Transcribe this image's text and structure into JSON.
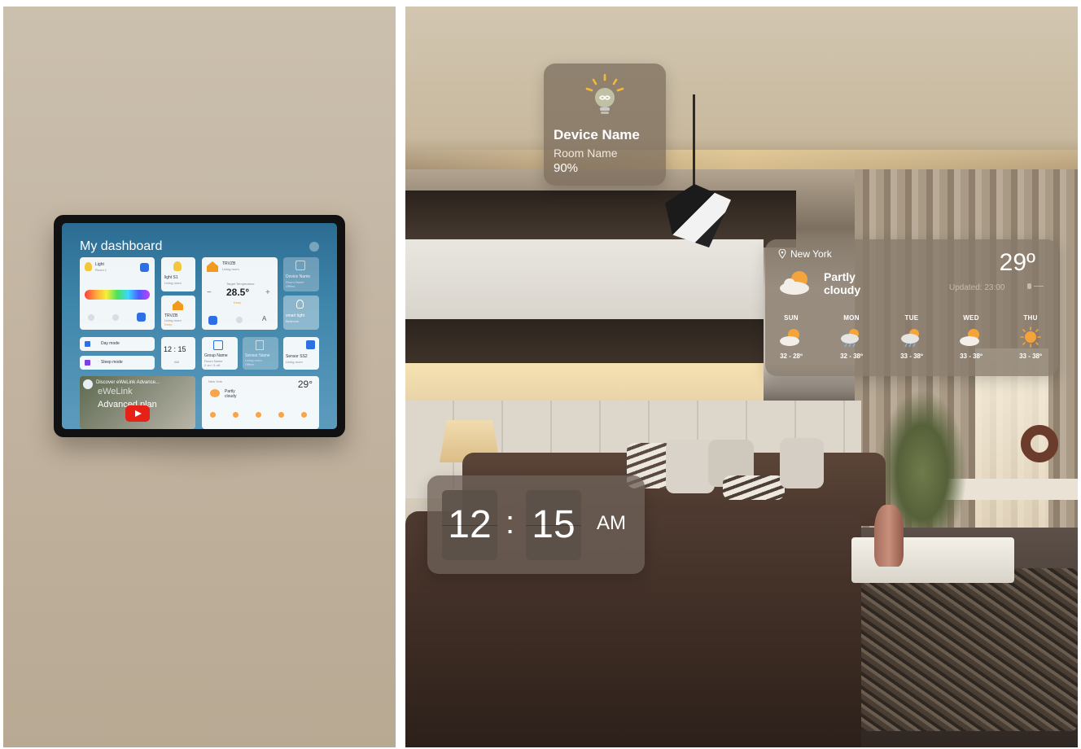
{
  "tablet": {
    "title": "My dashboard",
    "cards": {
      "light": {
        "name": "Light",
        "room": "Room 1"
      },
      "light_s1": {
        "name": "light S1",
        "room": "Living room"
      },
      "trvzb_a": {
        "name": "TRVZB",
        "room": "Living room",
        "target_label": "Target Temperature",
        "target": "28.5°",
        "mode": "Keep"
      },
      "trvzb_b": {
        "name": "TRVZB",
        "room": "Living room",
        "status": "Keep"
      },
      "dim_device": {
        "name": "Device Name",
        "room": "Room Name",
        "status": "Offline"
      },
      "smart_light": {
        "name": "smart light",
        "room": "Bedroom"
      },
      "day_mode": "Day mode",
      "sleep_mode": "Sleep mode",
      "clock": "12 : 15",
      "clock_sub": "AM",
      "group": {
        "name": "Group Name",
        "room": "Room Name",
        "sub": "2 on / 3 off"
      },
      "sensor_dim": {
        "name": "Sensor Name",
        "room": "Living room",
        "status": "Offline"
      },
      "sensor_ss": {
        "name": "Sensor SS2",
        "room": "Living room"
      },
      "video": {
        "channel": "eWeLink",
        "title": "Discover eWeLink Advance...",
        "overlay": "Advanced plan"
      },
      "weather": {
        "city": "New York",
        "temp": "29°",
        "cond": "Partly cloudy"
      }
    }
  },
  "device_widget": {
    "icon": "lightbulb-icon",
    "name": "Device Name",
    "room": "Room Name",
    "level": "90%"
  },
  "weather_widget": {
    "city": "New York",
    "temperature": "29º",
    "condition": "Partly cloudy",
    "updated": "Updated: 23:00",
    "forecast": [
      {
        "day": "SUN",
        "range": "32 - 28º",
        "icon": "partly-cloudy-icon"
      },
      {
        "day": "MON",
        "range": "32 - 38º",
        "icon": "rain-icon"
      },
      {
        "day": "TUE",
        "range": "33 - 38º",
        "icon": "rain-icon"
      },
      {
        "day": "WED",
        "range": "33 - 38º",
        "icon": "partly-cloudy-icon"
      },
      {
        "day": "THU",
        "range": "33 - 38º",
        "icon": "sun-icon"
      }
    ]
  },
  "clock_widget": {
    "hours": "12",
    "separator": ":",
    "minutes": "15",
    "period": "AM"
  },
  "colors": {
    "accent": "#2f6fe4",
    "glass": "#7a6a5b",
    "tablet_bg": "#3f86ab"
  }
}
